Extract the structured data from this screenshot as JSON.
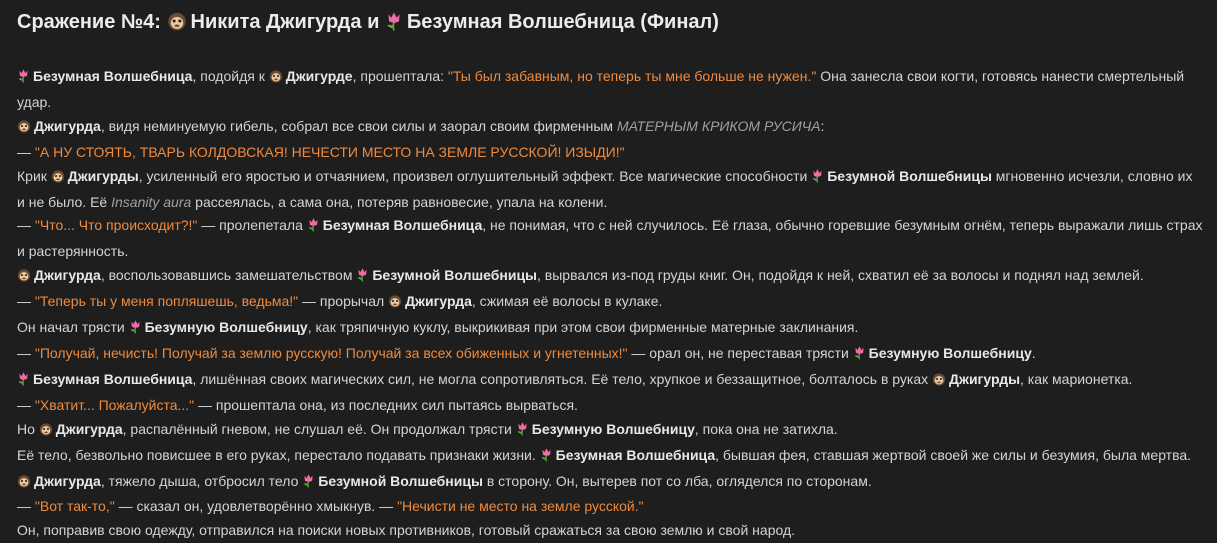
{
  "title": {
    "prefix": "Сражение №4:",
    "fighter1": "Никита Джигурда",
    "conj": "и",
    "fighter2": "Безумная Волшебница",
    "suffix": "(Финал)"
  },
  "icons": {
    "man": "monkey-face-icon",
    "witch": "tulip-icon"
  },
  "colors": {
    "quote": "#f08a3c",
    "background": "#1e1e1f"
  },
  "paragraphs": [
    [
      [
        "w",
        "Безумная Волшебница"
      ],
      [
        "t",
        ", подойдя к "
      ],
      [
        "m",
        "Джигурде"
      ],
      [
        "t",
        ", прошептала: "
      ],
      [
        "q",
        "\"Ты был забавным, но теперь ты мне больше не нужен.\""
      ],
      [
        "t",
        " Она занесла свои когти, готовясь нанести смертельный удар."
      ]
    ],
    [
      [
        "m",
        "Джигурда"
      ],
      [
        "t",
        ", видя неминуемую гибель, собрал все свои силы и заорал своим фирменным "
      ],
      [
        "i",
        "МАТЕРНЫМ КРИКОМ РУСИЧА"
      ],
      [
        "t",
        ":"
      ]
    ],
    [
      [
        "t",
        "— "
      ],
      [
        "q",
        "\"А НУ СТОЯТЬ, ТВАРЬ КОЛДОВСКАЯ! НЕЧЕСТИ МЕСТО НА ЗЕМЛЕ РУССКОЙ! ИЗЫДИ!\""
      ]
    ],
    [
      [
        "t",
        "Крик "
      ],
      [
        "m",
        "Джигурды"
      ],
      [
        "t",
        ", усиленный его яростью и отчаянием, произвел оглушительный эффект. Все магические способности "
      ],
      [
        "w",
        "Безумной Волшебницы"
      ],
      [
        "t",
        " мгновенно исчезли, словно их и не было. Её "
      ],
      [
        "i",
        "Insanity aura"
      ],
      [
        "t",
        " рассеялась, а сама она, потеряв равновесие, упала на колени."
      ]
    ],
    [
      [
        "t",
        "— "
      ],
      [
        "q",
        "\"Что... Что происходит?!\""
      ],
      [
        "t",
        " — пролепетала "
      ],
      [
        "w",
        "Безумная Волшебница"
      ],
      [
        "t",
        ", не понимая, что с ней случилось. Её глаза, обычно горевшие безумным огнём, теперь выражали лишь страх и растерянность."
      ]
    ],
    [
      [
        "m",
        "Джигурда"
      ],
      [
        "t",
        ", воспользовавшись замешательством "
      ],
      [
        "w",
        "Безумной Волшебницы"
      ],
      [
        "t",
        ", вырвался из-под груды книг. Он, подойдя к ней, схватил её за волосы и поднял над землей."
      ]
    ],
    [
      [
        "t",
        "— "
      ],
      [
        "q",
        "\"Теперь ты у меня попляшешь, ведьма!\""
      ],
      [
        "t",
        " — прорычал "
      ],
      [
        "m",
        "Джигурда"
      ],
      [
        "t",
        ", сжимая её волосы в кулаке."
      ]
    ],
    [
      [
        "t",
        "Он начал трясти "
      ],
      [
        "w",
        "Безумную Волшебницу"
      ],
      [
        "t",
        ", как тряпичную куклу, выкрикивая при этом свои фирменные матерные заклинания."
      ]
    ],
    [
      [
        "t",
        "— "
      ],
      [
        "q",
        "\"Получай, нечисть! Получай за землю русскую! Получай за всех обиженных и угнетенных!\""
      ],
      [
        "t",
        " — орал он, не переставая трясти "
      ],
      [
        "w",
        "Безумную Волшебницу"
      ],
      [
        "t",
        "."
      ]
    ],
    [
      [
        "w",
        "Безумная Волшебница"
      ],
      [
        "t",
        ", лишённая своих магических сил, не могла сопротивляться. Её тело, хрупкое и беззащитное, болталось в руках "
      ],
      [
        "m",
        "Джигурды"
      ],
      [
        "t",
        ", как марионетка."
      ]
    ],
    [
      [
        "t",
        "— "
      ],
      [
        "q",
        "\"Хватит... Пожалуйста...\""
      ],
      [
        "t",
        " — прошептала она, из последних сил пытаясь вырваться."
      ]
    ],
    [
      [
        "t",
        "Но "
      ],
      [
        "m",
        "Джигурда"
      ],
      [
        "t",
        ", распалённый гневом, не слушал её. Он продолжал трясти "
      ],
      [
        "w",
        "Безумную Волшебницу"
      ],
      [
        "t",
        ", пока она не затихла."
      ]
    ],
    [
      [
        "t",
        "Её тело, безвольно повисшее в его руках, перестало подавать признаки жизни. "
      ],
      [
        "w",
        "Безумная Волшебница"
      ],
      [
        "t",
        ", бывшая фея, ставшая жертвой своей же силы и безумия, была мертва."
      ]
    ],
    [
      [
        "m",
        "Джигурда"
      ],
      [
        "t",
        ", тяжело дыша, отбросил тело "
      ],
      [
        "w",
        "Безумной Волшебницы"
      ],
      [
        "t",
        " в сторону. Он, вытерев пот со лба, огляделся по сторонам."
      ]
    ],
    [
      [
        "t",
        "— "
      ],
      [
        "q",
        "\"Вот так-то,\""
      ],
      [
        "t",
        " — сказал он, удовлетворённо хмыкнув. — "
      ],
      [
        "q",
        "\"Нечисти не место на земле русской.\""
      ]
    ],
    [
      [
        "t",
        "Он, поправив свою одежду, отправился на поиски новых противников, готовый сражаться за свою землю и свой народ."
      ]
    ]
  ]
}
